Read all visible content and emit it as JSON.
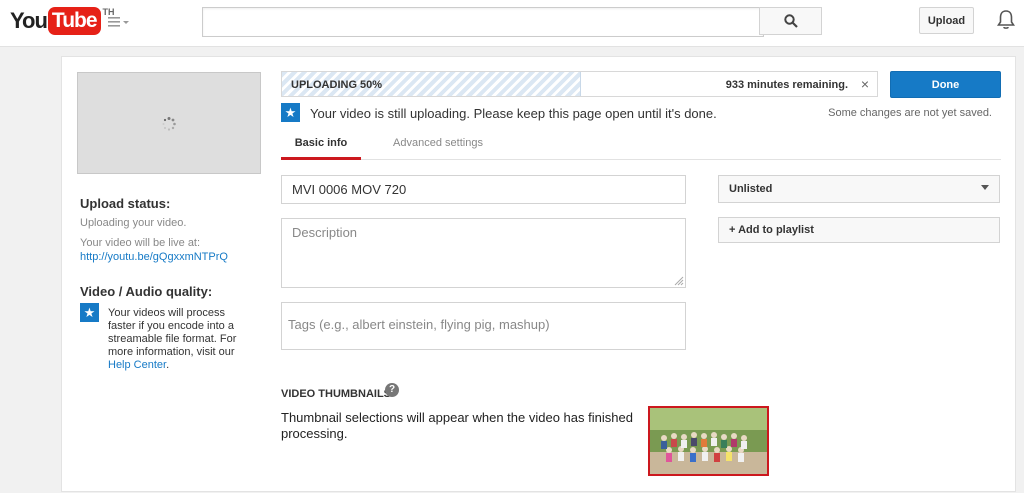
{
  "header": {
    "logo_you": "You",
    "logo_tube": "Tube",
    "country_code": "TH",
    "search_placeholder": "",
    "upload_label": "Upload"
  },
  "sidebar": {
    "upload_status_heading": "Upload status:",
    "upload_status_text": "Uploading your video.",
    "live_at_text": "Your video will be live at:",
    "live_link": "http://youtu.be/gQgxxmNTPrQ",
    "quality_heading": "Video / Audio quality:",
    "quality_text": "Your videos will process faster if you encode into a streamable file format. For more information, visit our",
    "help_center": "Help Center",
    "period": "."
  },
  "progress": {
    "label": "UPLOADING 50%",
    "percent": 50,
    "remaining": "933 minutes remaining.",
    "done_label": "Done"
  },
  "notice": {
    "text": "Your video is still uploading. Please keep this page open until it's done.",
    "unsaved": "Some changes are not yet saved."
  },
  "tabs": [
    {
      "label": "Basic info",
      "active": true
    },
    {
      "label": "Advanced settings",
      "active": false
    }
  ],
  "form": {
    "title_value": "MVI 0006 MOV 720",
    "description_placeholder": "Description",
    "tags_placeholder": "Tags (e.g., albert einstein, flying pig, mashup)",
    "privacy_value": "Unlisted",
    "playlist_label": "+ Add to playlist"
  },
  "thumbnails": {
    "heading": "VIDEO THUMBNAILS",
    "help": "?",
    "text": "Thumbnail selections will appear when the video has finished processing."
  },
  "colors": {
    "brand_red": "#e62117",
    "accent_blue": "#167ac6",
    "tab_red": "#cc181e"
  }
}
